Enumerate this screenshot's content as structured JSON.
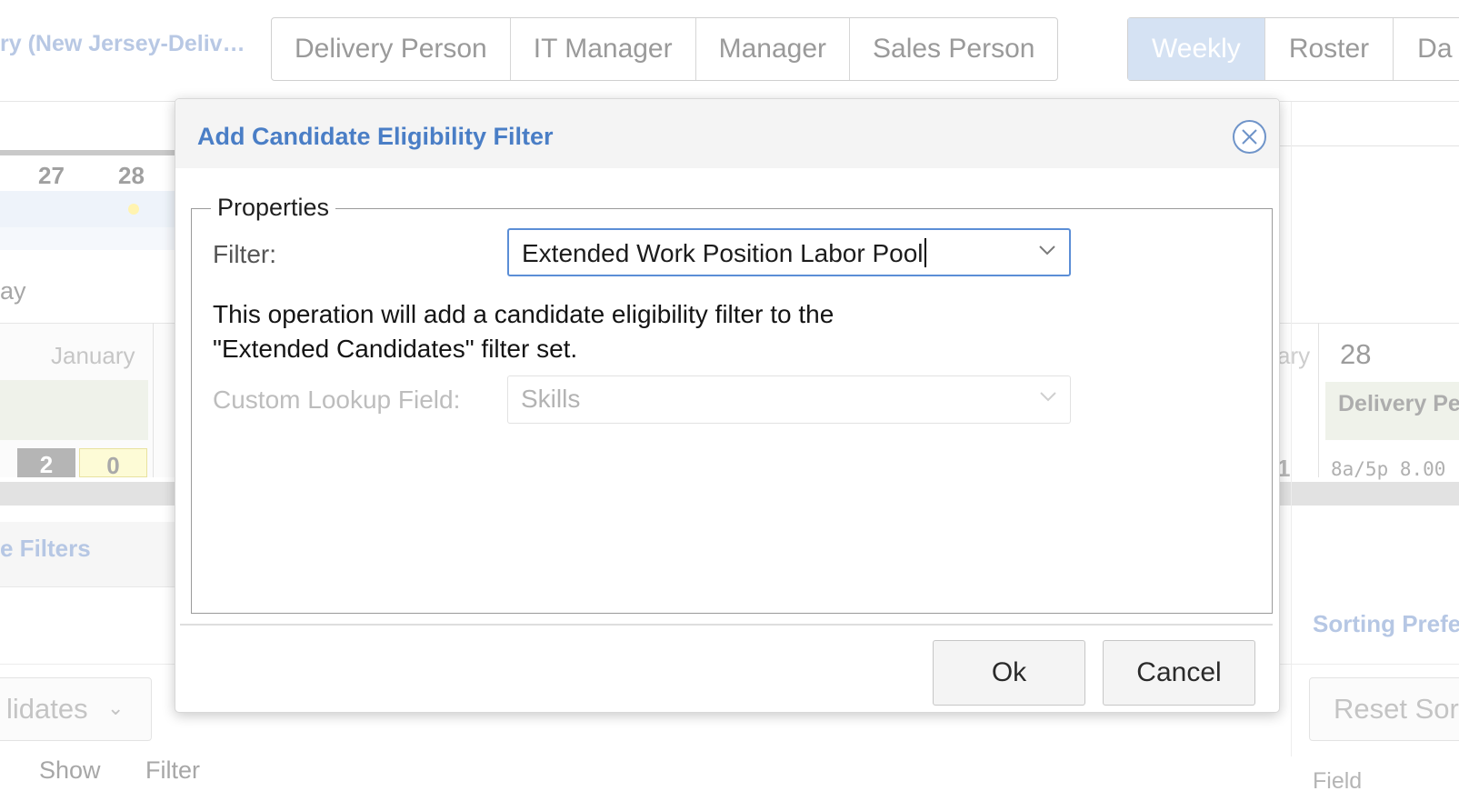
{
  "background": {
    "region_title": "ry (New Jersey-Deliv…",
    "role_tabs": [
      "Delivery Person",
      "IT Manager",
      "Manager",
      "Sales Person"
    ],
    "view_tabs": [
      "Weekly",
      "Roster",
      "Da"
    ],
    "active_view": "Weekly",
    "days": [
      "27",
      "28"
    ],
    "day_label": "ay",
    "month_label": "January",
    "month_label_right": "ary",
    "counts": [
      "2",
      "0"
    ],
    "right_day": "28",
    "right_role": "Delivery Pe",
    "right_time": "8a/5p 8.00",
    "right_count": "1",
    "filters_heading": "e Filters",
    "sorting_heading": "Sorting Prefe",
    "filter_set_select": "lidates",
    "reset_sort_button": "Reset Sor",
    "col_show": "Show",
    "col_filter": "Filter",
    "col_field": "Field"
  },
  "dialog": {
    "title": "Add Candidate Eligibility Filter",
    "legend": "Properties",
    "filter_label": "Filter:",
    "filter_value": "Extended Work Position Labor Pool",
    "description_line1": "This operation will add a candidate eligibility filter to the",
    "description_line2": "\"Extended Candidates\" filter set.",
    "custom_lookup_label": "Custom Lookup Field:",
    "custom_lookup_value": "Skills",
    "ok_label": "Ok",
    "cancel_label": "Cancel"
  },
  "colors": {
    "title_blue": "#4a7ec6",
    "focus_border": "#5b8ed6",
    "active_view_bg": "#d5e2f3"
  }
}
